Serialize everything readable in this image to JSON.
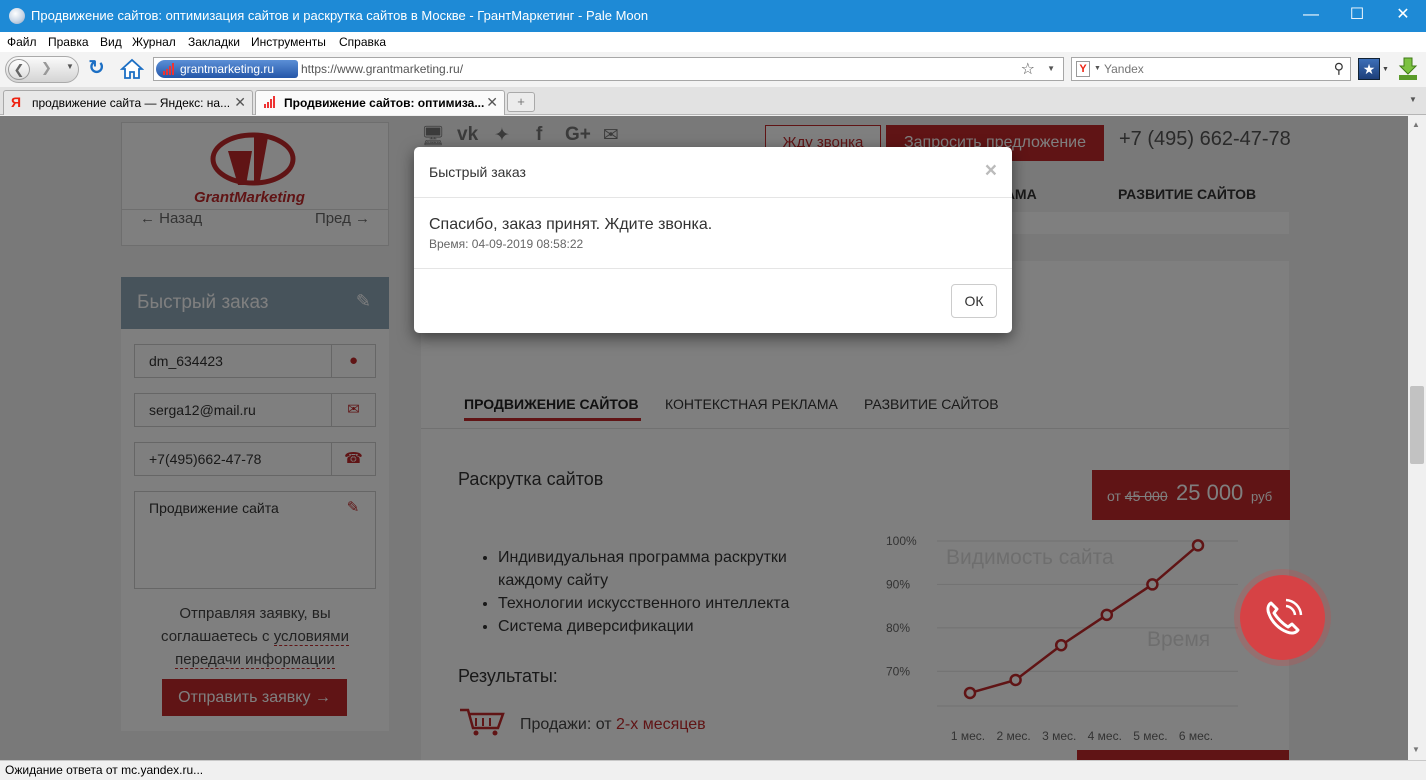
{
  "window": {
    "title": "Продвижение сайтов: оптимизация сайтов и раскрутка сайтов в Москве - ГрантМаркетинг - Pale Moon"
  },
  "menu": [
    "Файл",
    "Правка",
    "Вид",
    "Журнал",
    "Закладки",
    "Инструменты",
    "Справка"
  ],
  "navbar": {
    "identity": "grantmarketing.ru",
    "url": "https://www.grantmarketing.ru/",
    "search_placeholder": "Yandex"
  },
  "tabs": [
    {
      "label": "продвижение сайта — Яндекс: на..."
    },
    {
      "label": "Продвижение сайтов: оптимиза..."
    }
  ],
  "status": "Ожидание ответа от mc.yandex.ru...",
  "page": {
    "logo_text": "GrantMarketing",
    "pager": {
      "prev": "← Назад",
      "next": "Пред →"
    },
    "quick_order": {
      "title": "Быстрый заказ",
      "name": "dm_634423",
      "email": "serga12@mail.ru",
      "phone": "+7(495)662-47-78",
      "message": "Продвижение сайта",
      "note_1": "Отправляя заявку, вы соглашаетесь с ",
      "note_link": "условиями передачи информации",
      "submit": "Отправить заявку →"
    },
    "header": {
      "call_btn": "Жду звонка",
      "offer_btn": "Запросить предложение",
      "phone": "+7 (495) 662-47-78",
      "nav_partial": "ЛАМА",
      "nav_dev": "РАЗВИТИЕ САЙТОВ"
    },
    "main": {
      "tabs": [
        "ПРОДВИЖЕНИЕ САЙТОВ",
        "КОНТЕКСТНАЯ РЕКЛАМА",
        "РАЗВИТИЕ САЙТОВ"
      ],
      "heading": "Раскрутка сайтов",
      "price_from": "от",
      "price_old": "45 000",
      "price_value": "25 000",
      "price_currency": "руб",
      "bullets": [
        "Индивидуальная программа раскрутки каждому сайту",
        "Технологии искусственного интеллекта",
        "Система диверсификации"
      ],
      "results": "Результаты:",
      "sales_label": "Продажи: от ",
      "sales_value": "2-х месяцев"
    }
  },
  "modal": {
    "title": "Быстрый заказ",
    "close": "×",
    "message": "Спасибо, заказ принят. Ждите звонка.",
    "time": "Время: 04-09-2019 08:58:22",
    "ok": "ОК"
  },
  "chart_data": {
    "type": "line",
    "title": "Видимость сайта",
    "xlabel": "Время",
    "ylabel": "",
    "categories": [
      "1 мес.",
      "2 мес.",
      "3 мес.",
      "4 мес.",
      "5 мес.",
      "6 мес."
    ],
    "y_ticks": [
      "100%",
      "90%",
      "80%",
      "70%"
    ],
    "ylim": [
      62,
      100
    ],
    "series": [
      {
        "values": [
          65,
          68,
          76,
          83,
          90,
          99
        ]
      }
    ],
    "color": "#c0292a"
  }
}
